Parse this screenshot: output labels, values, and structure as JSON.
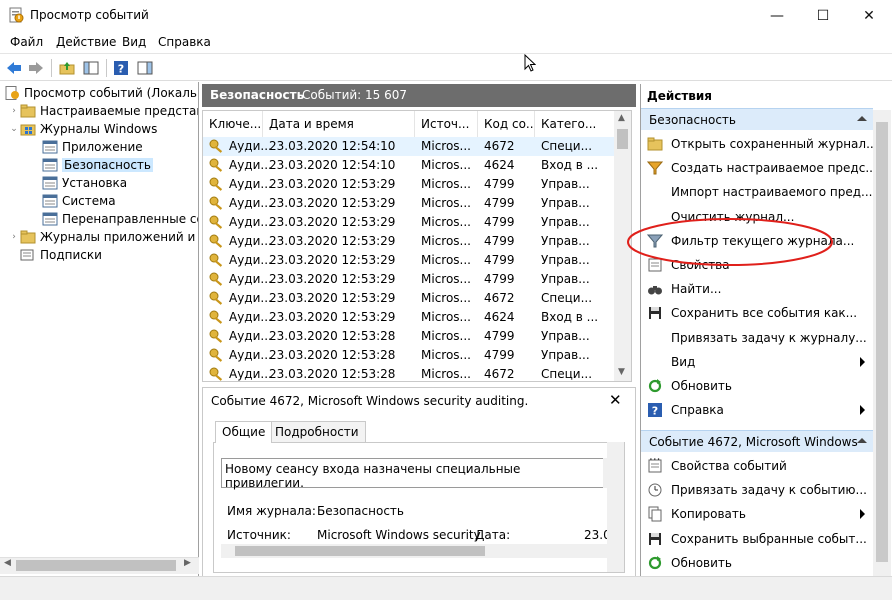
{
  "window": {
    "title": "Просмотр событий",
    "minimize": "—",
    "maximize": "☐",
    "close": "✕"
  },
  "menu": [
    "Файл",
    "Действие",
    "Вид",
    "Справка"
  ],
  "tree": {
    "items": [
      {
        "label": "Просмотр событий (Локальны",
        "indent": 0,
        "arrow": "",
        "icon": "event-viewer-icon"
      },
      {
        "label": "Настраиваемые представле",
        "indent": 1,
        "arrow": "›",
        "icon": "folder-icon"
      },
      {
        "label": "Журналы Windows",
        "indent": 1,
        "arrow": "⌄",
        "icon": "windows-logs-icon"
      },
      {
        "label": "Приложение",
        "indent": 2,
        "arrow": "",
        "icon": "log-icon"
      },
      {
        "label": "Безопасность",
        "indent": 2,
        "arrow": "",
        "icon": "log-icon",
        "selected": true
      },
      {
        "label": "Установка",
        "indent": 2,
        "arrow": "",
        "icon": "log-icon"
      },
      {
        "label": "Система",
        "indent": 2,
        "arrow": "",
        "icon": "log-icon"
      },
      {
        "label": "Перенаправленные соб",
        "indent": 2,
        "arrow": "",
        "icon": "log-icon"
      },
      {
        "label": "Журналы приложений и сл",
        "indent": 1,
        "arrow": "›",
        "icon": "folder-icon"
      },
      {
        "label": "Подписки",
        "indent": 1,
        "arrow": "",
        "icon": "subscriptions-icon"
      }
    ]
  },
  "center": {
    "title": "Безопасность",
    "count": "Событий: 15 607"
  },
  "events": {
    "columns": [
      "Ключе...",
      "Дата и время",
      "Источ...",
      "Код со...",
      "Катего..."
    ],
    "rows": [
      [
        "Ауди...",
        "23.03.2020 12:54:10",
        "Micros...",
        "4672",
        "Специ..."
      ],
      [
        "Ауди...",
        "23.03.2020 12:54:10",
        "Micros...",
        "4624",
        "Вход в ..."
      ],
      [
        "Ауди...",
        "23.03.2020 12:53:29",
        "Micros...",
        "4799",
        "Управ..."
      ],
      [
        "Ауди...",
        "23.03.2020 12:53:29",
        "Micros...",
        "4799",
        "Управ..."
      ],
      [
        "Ауди...",
        "23.03.2020 12:53:29",
        "Micros...",
        "4799",
        "Управ..."
      ],
      [
        "Ауди...",
        "23.03.2020 12:53:29",
        "Micros...",
        "4799",
        "Управ..."
      ],
      [
        "Ауди...",
        "23.03.2020 12:53:29",
        "Micros...",
        "4799",
        "Управ..."
      ],
      [
        "Ауди...",
        "23.03.2020 12:53:29",
        "Micros...",
        "4799",
        "Управ..."
      ],
      [
        "Ауди...",
        "23.03.2020 12:53:29",
        "Micros...",
        "4672",
        "Специ..."
      ],
      [
        "Ауди...",
        "23.03.2020 12:53:29",
        "Micros...",
        "4624",
        "Вход в ..."
      ],
      [
        "Ауди...",
        "23.03.2020 12:53:28",
        "Micros...",
        "4799",
        "Управ..."
      ],
      [
        "Ауди...",
        "23.03.2020 12:53:28",
        "Micros...",
        "4799",
        "Управ..."
      ],
      [
        "Ауди...",
        "23.03.2020 12:53:28",
        "Micros...",
        "4672",
        "Специ..."
      ]
    ]
  },
  "detail": {
    "title": "Событие 4672, Microsoft Windows security auditing.",
    "close": "✕",
    "tabs": [
      "Общие",
      "Подробности"
    ],
    "message": "Новому сеансу входа назначены специальные привилегии.",
    "log_name_label": "Имя журнала:",
    "log_name_value": "Безопасность",
    "source_label": "Источник:",
    "source_value": "Microsoft Windows security",
    "date_label": "Дата:",
    "date_value": "23.0"
  },
  "actions": {
    "header": "Действия",
    "section1": {
      "title": "Безопасность",
      "items": [
        {
          "label": "Открыть сохраненный журнал...",
          "icon": "open-folder-icon"
        },
        {
          "label": "Создать настраиваемое предс...",
          "icon": "filter-create-icon"
        },
        {
          "label": "Импорт настраиваемого пред...",
          "icon": ""
        },
        {
          "label": "Очистить журнал...",
          "icon": ""
        },
        {
          "label": "Фильтр текущего журнала...",
          "icon": "filter-icon"
        },
        {
          "label": "Свойства",
          "icon": "properties-icon"
        },
        {
          "label": "Найти...",
          "icon": "binoculars-icon"
        },
        {
          "label": "Сохранить все события как...",
          "icon": "save-icon"
        },
        {
          "label": "Привязать задачу к журналу...",
          "icon": ""
        },
        {
          "label": "Вид",
          "icon": "",
          "submenu": true
        },
        {
          "label": "Обновить",
          "icon": "refresh-icon"
        },
        {
          "label": "Справка",
          "icon": "help-icon",
          "submenu": true
        }
      ]
    },
    "section2": {
      "title": "Событие 4672, Microsoft Windows ...",
      "items": [
        {
          "label": "Свойства событий",
          "icon": "event-properties-icon"
        },
        {
          "label": "Привязать задачу к событию...",
          "icon": "task-icon"
        },
        {
          "label": "Копировать",
          "icon": "copy-icon",
          "submenu": true
        },
        {
          "label": "Сохранить выбранные событ...",
          "icon": "save-icon"
        },
        {
          "label": "Обновить",
          "icon": "refresh-icon"
        }
      ]
    }
  }
}
